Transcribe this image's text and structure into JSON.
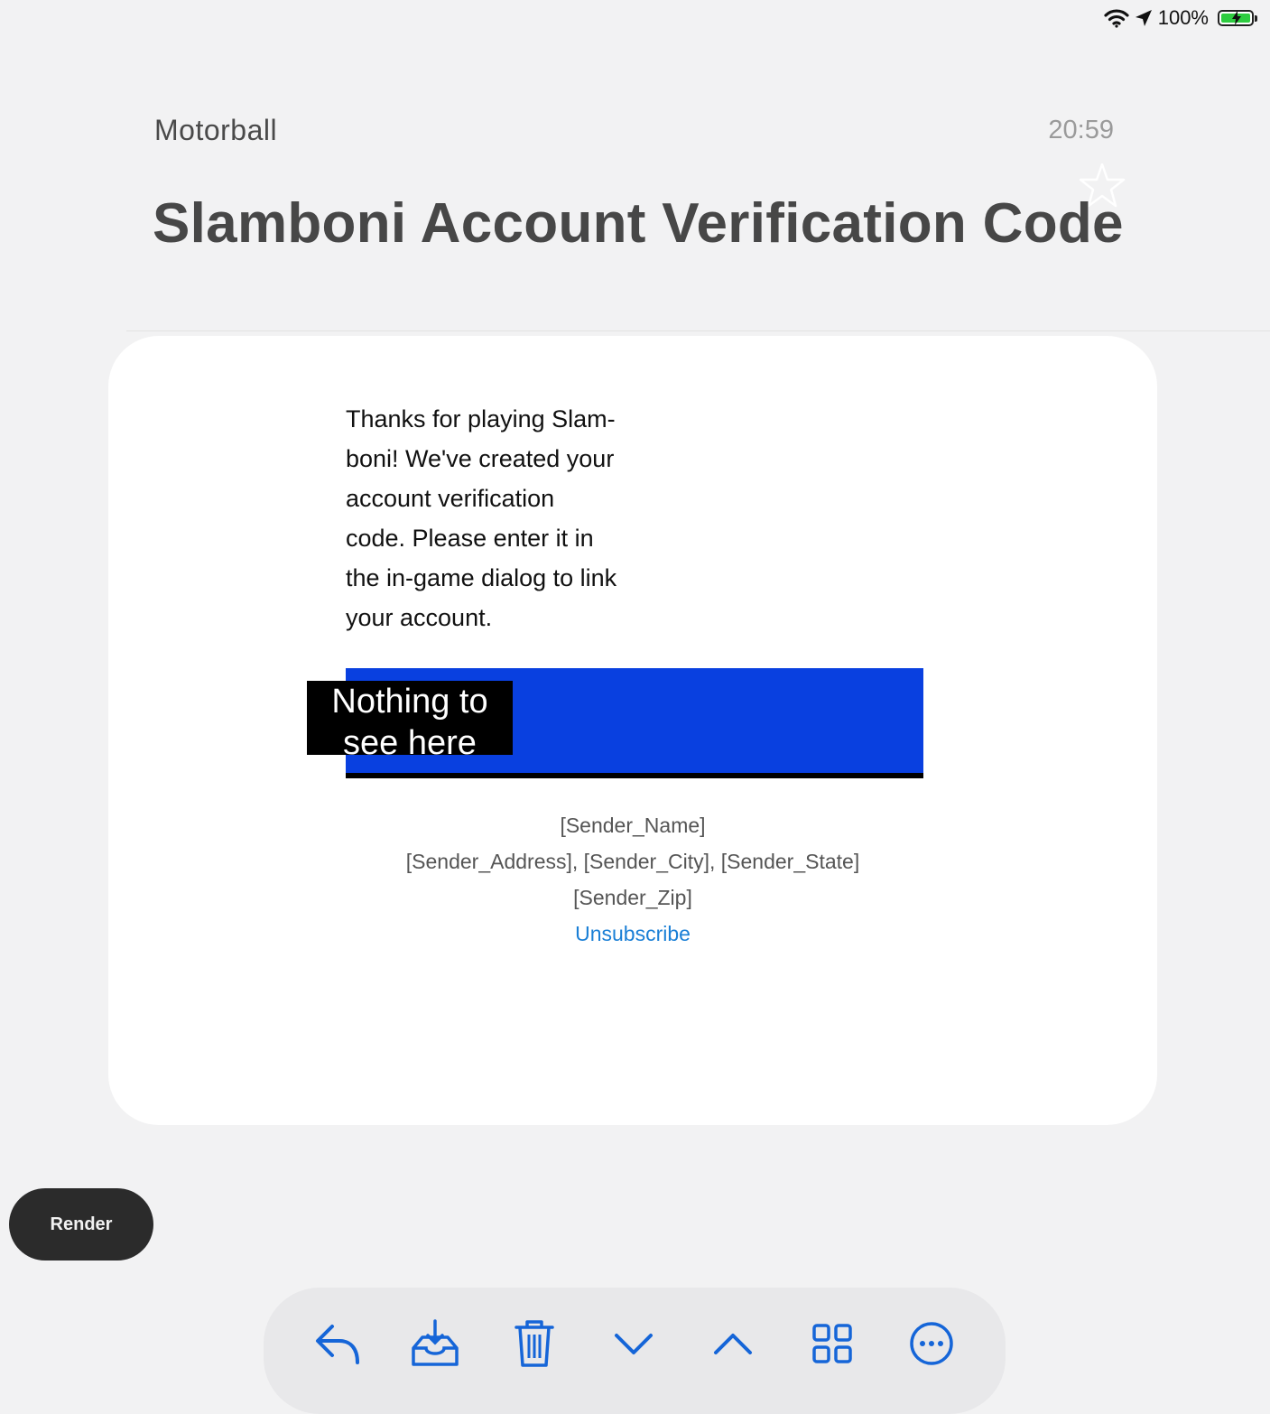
{
  "status_bar": {
    "battery_percent": "100%",
    "battery_level": 1.0,
    "battery_color": "#2ecc40",
    "icons": [
      "wifi-icon",
      "location-arrow-icon",
      "battery-charging-icon"
    ]
  },
  "email": {
    "sender": "Motorball",
    "time": "20:59",
    "subject": "Slamboni Account Verification Code",
    "starred": false,
    "body_lines": [
      "Thanks for playing Slam-",
      "boni!  We've created your",
      "account verification",
      "code.  Please enter it in",
      "the in-game dialog to link",
      "your account."
    ],
    "code_banner_color": "#0940e0",
    "redaction_lines": [
      "Nothing to",
      "see here"
    ],
    "footer": {
      "name": "[Sender_Name]",
      "address_line": "[Sender_Address], [Sender_City], [Sender_State]",
      "zip": "[Sender_Zip]",
      "unsubscribe": "Unsubscribe"
    }
  },
  "render_button": {
    "label": "Render"
  },
  "toolbar": {
    "accent": "#1565d8",
    "items": [
      "reply-icon",
      "archive-icon",
      "trash-icon",
      "next-down-icon",
      "previous-up-icon",
      "grid-icon",
      "more-icon"
    ]
  }
}
